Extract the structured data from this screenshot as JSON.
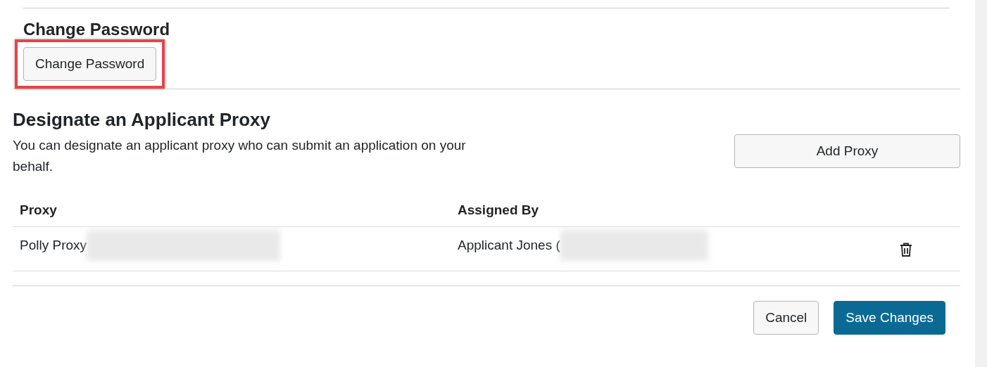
{
  "password_section": {
    "title": "Change Password",
    "button": {
      "label": "Change Password",
      "highlighted": true
    }
  },
  "proxy_section": {
    "title": "Designate an Applicant Proxy",
    "description": "You can designate an applicant proxy who can submit an application on your behalf.",
    "add_button": "Add Proxy",
    "table": {
      "columns": [
        "Proxy",
        "Assigned By"
      ],
      "rows": [
        {
          "proxy": {
            "text": "Polly Proxy",
            "redacted": true
          },
          "assigned_by": {
            "text": "Applicant Jones (",
            "redacted": true
          }
        }
      ]
    }
  },
  "footer": {
    "buttons": [
      {
        "label": "Cancel",
        "kind": "secondary"
      },
      {
        "label": "Save Changes",
        "kind": "primary"
      }
    ]
  }
}
